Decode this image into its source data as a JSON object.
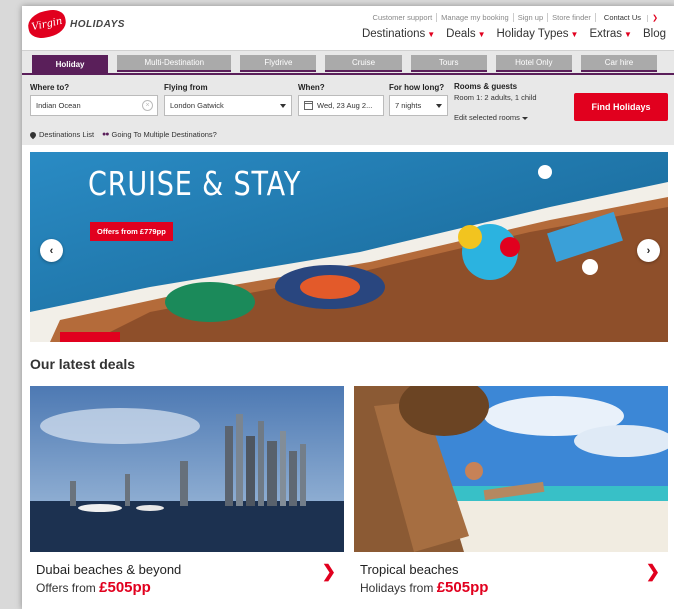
{
  "brand": {
    "badge": "Virgin",
    "name": "HOLIDAYS"
  },
  "utility_nav": [
    "Customer support",
    "Manage my booking",
    "Sign up",
    "Store finder"
  ],
  "contact": "Contact Us",
  "main_nav": [
    {
      "label": "Destinations",
      "dropdown": true
    },
    {
      "label": "Deals",
      "dropdown": true
    },
    {
      "label": "Holiday Types",
      "dropdown": true
    },
    {
      "label": "Extras",
      "dropdown": true
    },
    {
      "label": "Blog",
      "dropdown": false
    }
  ],
  "tabs": [
    "Holiday",
    "Multi-Destination",
    "Flydrive",
    "Cruise",
    "Tours",
    "Hotel Only",
    "Car hire"
  ],
  "active_tab": "Holiday",
  "search": {
    "where_label": "Where to?",
    "where_value": "Indian Ocean",
    "from_label": "Flying from",
    "from_value": "London Gatwick",
    "when_label": "When?",
    "when_value": "Wed, 23 Aug 2...",
    "duration_label": "For how long?",
    "duration_value": "7 nights",
    "rooms_label": "Rooms & guests",
    "rooms_value": "Room 1: 2 adults, 1 child",
    "edit_rooms": "Edit selected rooms",
    "find_button": "Find Holidays",
    "destinations_list": "Destinations List",
    "multi_destinations": "Going To Multiple Destinations?"
  },
  "hero": {
    "title": "CRUISE & STAY",
    "offer": "Offers from £779pp",
    "prev": "‹",
    "next": "›"
  },
  "deals": {
    "title": "Our latest deals",
    "items": [
      {
        "name": "Dubai beaches & beyond",
        "offer_prefix": "Offers from",
        "price": "£505pp"
      },
      {
        "name": "Tropical beaches",
        "offer_prefix": "Holidays from",
        "price": "£505pp"
      }
    ]
  },
  "colors": {
    "brand_red": "#e1001e",
    "brand_purple": "#5a1f5a",
    "search_bg": "#e8e8e8"
  },
  "icons": [
    "chevron-down-icon",
    "clear-icon",
    "calendar-icon",
    "pin-icon",
    "multi-pin-icon",
    "arrow-left-icon",
    "arrow-right-icon",
    "chevron-right-icon"
  ]
}
